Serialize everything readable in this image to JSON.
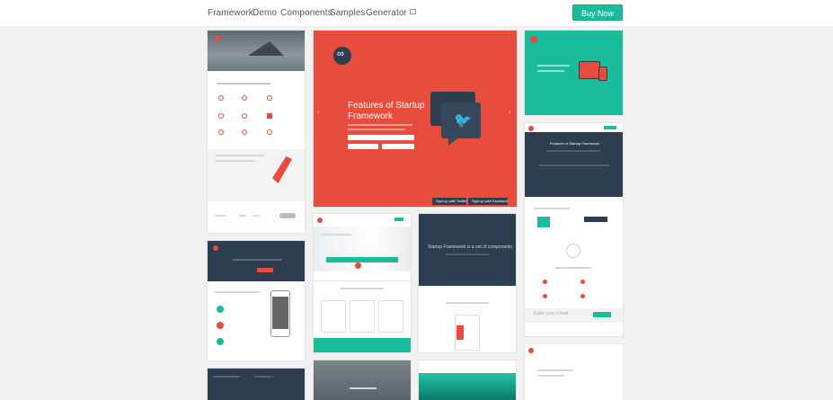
{
  "nav": {
    "framework": "Framework",
    "demo": "Demo",
    "components": "Components",
    "samples": "Samples",
    "generator": "Generator",
    "buy_now": "Buy Now"
  },
  "hero": {
    "title_line1": "Features of Startup",
    "title_line2": "Framework",
    "signup_twitter": "Sign up with Twitter",
    "signup_facebook": "Sign up with Facebook"
  },
  "thumbs": {
    "flat_title": "Startup Framework is a set of components",
    "bottom_email": "Enter your e-mail",
    "tab_title": "Features of Startup Framework"
  },
  "colors": {
    "accent": "#1abc9c",
    "hero": "#e74c3c",
    "dark": "#2c3e50"
  }
}
